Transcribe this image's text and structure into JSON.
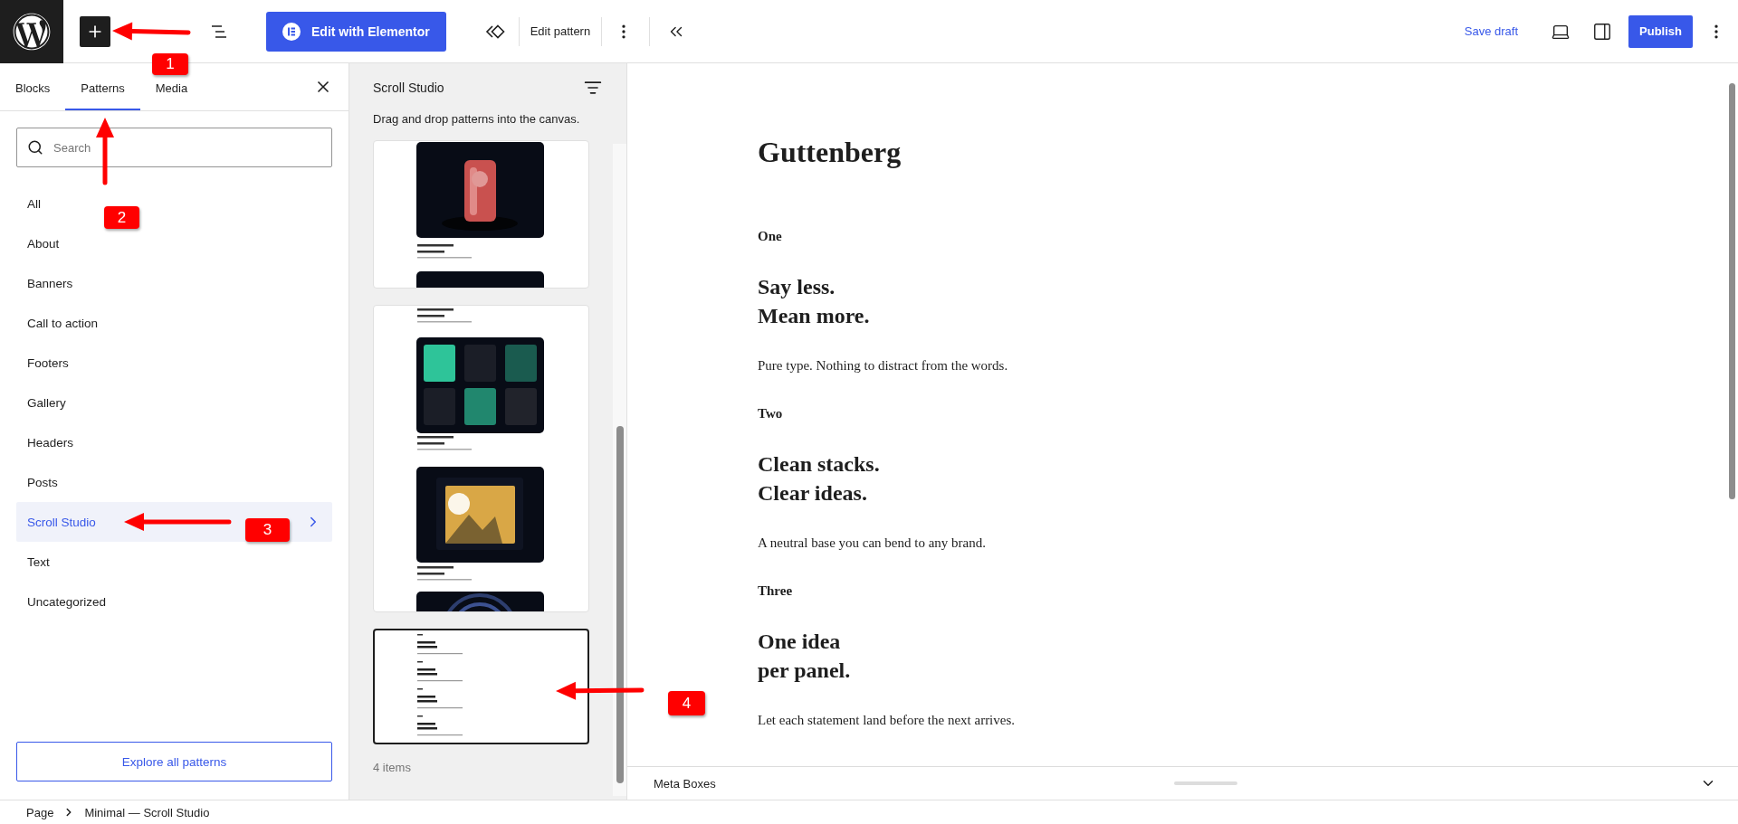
{
  "toolbar": {
    "edit_with_elementor": "Edit with Elementor",
    "edit_pattern": "Edit pattern",
    "save_draft": "Save draft",
    "publish": "Publish"
  },
  "inserter": {
    "tabs": [
      {
        "label": "Blocks",
        "selected": false
      },
      {
        "label": "Patterns",
        "selected": true
      },
      {
        "label": "Media",
        "selected": false
      }
    ],
    "search": {
      "placeholder": "Search"
    },
    "categories": [
      {
        "label": "All",
        "selected": false
      },
      {
        "label": "About",
        "selected": false
      },
      {
        "label": "Banners",
        "selected": false
      },
      {
        "label": "Call to action",
        "selected": false
      },
      {
        "label": "Footers",
        "selected": false
      },
      {
        "label": "Gallery",
        "selected": false
      },
      {
        "label": "Headers",
        "selected": false
      },
      {
        "label": "Posts",
        "selected": false
      },
      {
        "label": "Scroll Studio",
        "selected": true
      },
      {
        "label": "Text",
        "selected": false
      },
      {
        "label": "Uncategorized",
        "selected": false
      }
    ],
    "explore_button": "Explore all patterns"
  },
  "patterns_panel": {
    "title": "Scroll Studio",
    "hint": "Drag and drop patterns into the canvas.",
    "patterns": [
      {
        "kind": "showcase",
        "selected": false
      },
      {
        "kind": "gallery",
        "selected": false
      },
      {
        "kind": "text",
        "selected": true
      }
    ],
    "count": "4 items"
  },
  "canvas": {
    "title": "Guttenberg",
    "sections": [
      {
        "label": "One",
        "heading": "Say less.\nMean more.",
        "body": "Pure type. Nothing to distract from the words."
      },
      {
        "label": "Two",
        "heading": "Clean stacks.\nClear ideas.",
        "body": "A neutral base you can bend to any brand."
      },
      {
        "label": "Three",
        "heading": "One idea\nper panel.",
        "body": "Let each statement land before the next arrives."
      }
    ]
  },
  "meta_boxes": {
    "title": "Meta Boxes"
  },
  "breadcrumb": [
    "Page",
    "Minimal — Scroll Studio"
  ],
  "annotations": [
    {
      "number": "1"
    },
    {
      "number": "2"
    },
    {
      "number": "3"
    },
    {
      "number": "4"
    }
  ]
}
